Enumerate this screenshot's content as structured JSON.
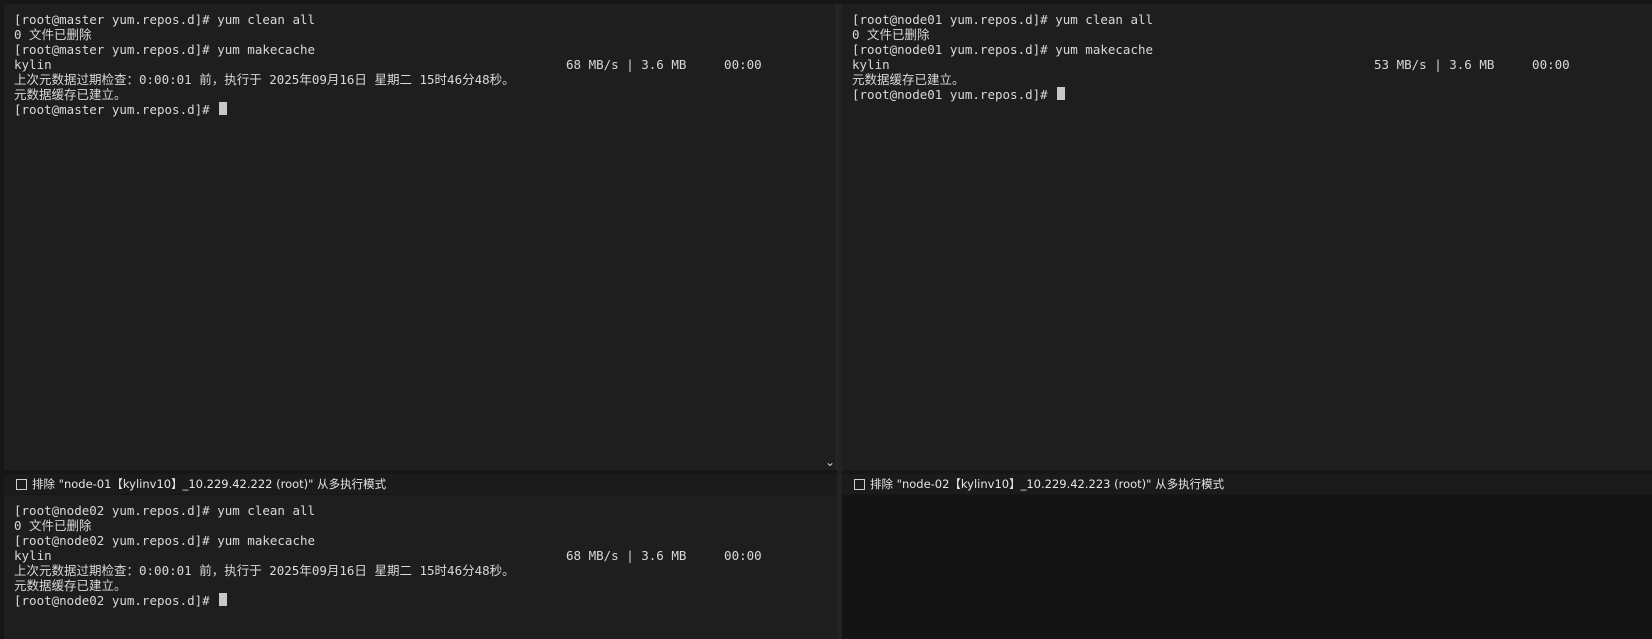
{
  "panes": {
    "top_left": {
      "lines": [
        "[root@master yum.repos.d]# yum clean all",
        "0 文件已删除",
        "[root@master yum.repos.d]# yum makecache"
      ],
      "repo_name": "kylin",
      "repo_stats": "68 MB/s | 3.6 MB     00:00",
      "after_lines": [
        "上次元数据过期检查：0:00:01 前，执行于 2025年09月16日 星期二 15时46分48秒。",
        "元数据缓存已建立。"
      ],
      "prompt": "[root@master yum.repos.d]# "
    },
    "top_right": {
      "lines": [
        "[root@node01 yum.repos.d]# yum clean all",
        "0 文件已删除",
        "[root@node01 yum.repos.d]# yum makecache"
      ],
      "repo_name": "kylin",
      "repo_stats": "53 MB/s | 3.6 MB     00:00",
      "after_lines": [
        "元数据缓存已建立。"
      ],
      "prompt": "[root@node01 yum.repos.d]# "
    },
    "bottom_left": {
      "lines": [
        "[root@node02 yum.repos.d]# yum clean all",
        "0 文件已删除",
        "[root@node02 yum.repos.d]# yum makecache"
      ],
      "repo_name": "kylin",
      "repo_stats": "68 MB/s | 3.6 MB     00:00",
      "after_lines": [
        "上次元数据过期检查：0:00:01 前，执行于 2025年09月16日 星期二 15时46分48秒。",
        "元数据缓存已建立。"
      ],
      "prompt": "[root@node02 yum.repos.d]# "
    }
  },
  "exclude_bars": {
    "left_label": "排除 \"node-01【kylinv10】_10.229.42.222 (root)\" 从多执行模式",
    "right_label": "排除 \"node-02【kylinv10】_10.229.42.223 (root)\" 从多执行模式"
  },
  "icons": {
    "scroll": "chevron-down-icon"
  },
  "colors": {
    "terminal_bg": "#1e1e1e",
    "terminal_fg": "#d9d9d9",
    "cursor": "#c8c8c8"
  }
}
